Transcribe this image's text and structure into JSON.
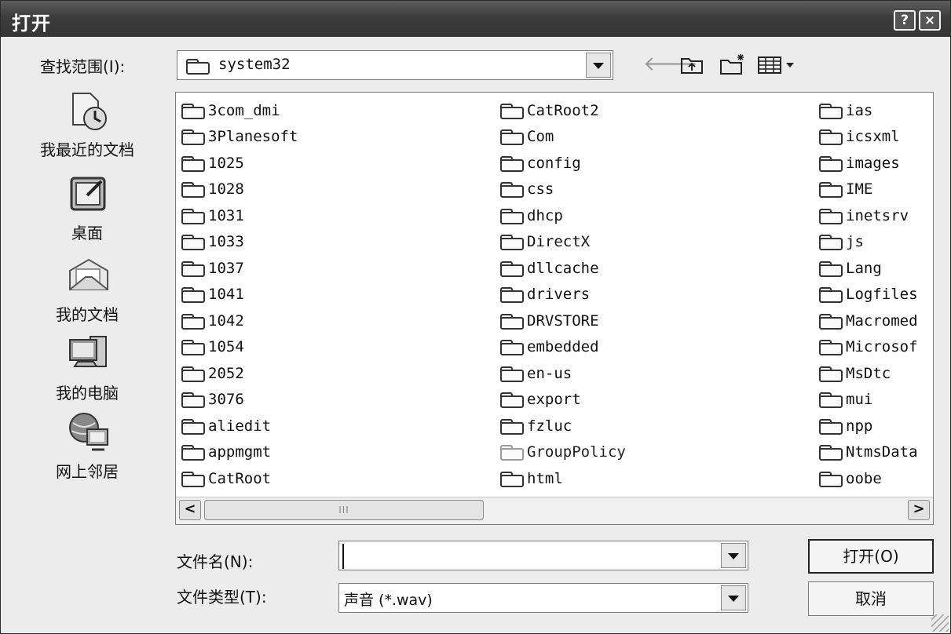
{
  "dialog": {
    "title": "打开",
    "help_button": "?",
    "close_button": "×"
  },
  "lookin": {
    "label": "查找范围(I):",
    "value": "system32"
  },
  "toolbar": {
    "back_icon": "arrow-left",
    "up_icon": "folder-up",
    "new_folder_icon": "new-folder",
    "view_menu_icon": "view-menu"
  },
  "places": [
    {
      "label": "我最近的文档",
      "icon": "recent-documents"
    },
    {
      "label": "桌面",
      "icon": "desktop"
    },
    {
      "label": "我的文档",
      "icon": "my-documents"
    },
    {
      "label": "我的电脑",
      "icon": "my-computer"
    },
    {
      "label": "网上邻居",
      "icon": "network-places"
    }
  ],
  "files": {
    "col1": [
      "3com_dmi",
      "3Planesoft",
      "1025",
      "1028",
      "1031",
      "1033",
      "1037",
      "1041",
      "1042",
      "1054",
      "2052",
      "3076",
      "aliedit",
      "appmgmt",
      "CatRoot"
    ],
    "col2": [
      "CatRoot2",
      "Com",
      "config",
      "css",
      "dhcp",
      "DirectX",
      "dllcache",
      "drivers",
      "DRVSTORE",
      "embedded",
      "en-us",
      "export",
      "fzluc",
      "GroupPolicy",
      "html"
    ],
    "col3": [
      "ias",
      "icsxml",
      "images",
      "IME",
      "inetsrv",
      "js",
      "Lang",
      "Logfiles",
      "Macromed",
      "Microsof",
      "MsDtc",
      "mui",
      "npp",
      "NtmsData",
      "oobe"
    ]
  },
  "scrollbar": {
    "thumb_grip": "III",
    "left": "<",
    "right": ">"
  },
  "filename": {
    "label": "文件名(N):",
    "value": ""
  },
  "filetype": {
    "label": "文件类型(T):",
    "value": "声音  (*.wav)"
  },
  "buttons": {
    "open": "打开(O)",
    "cancel": "取消"
  }
}
